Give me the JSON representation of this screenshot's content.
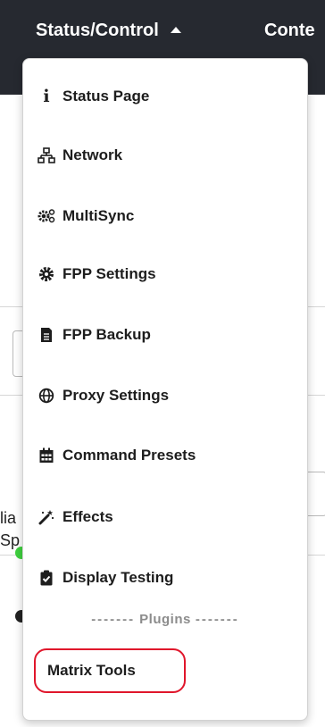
{
  "navbar": {
    "status_control_label": "Status/Control",
    "content_label_partial": "Conte"
  },
  "background": {
    "text_1": "lia",
    "text_2": "Sp"
  },
  "menu": {
    "items": [
      {
        "label": "Status Page",
        "icon": "info-icon"
      },
      {
        "label": "Network",
        "icon": "network-icon"
      },
      {
        "label": "MultiSync",
        "icon": "cogs-icon"
      },
      {
        "label": "FPP Settings",
        "icon": "gear-icon"
      },
      {
        "label": "FPP Backup",
        "icon": "file-icon"
      },
      {
        "label": "Proxy Settings",
        "icon": "globe-icon"
      },
      {
        "label": "Command Presets",
        "icon": "calendar-icon"
      },
      {
        "label": "Effects",
        "icon": "magic-wand-icon"
      },
      {
        "label": "Display Testing",
        "icon": "clipboard-check-icon"
      }
    ],
    "plugins_header": {
      "dashes_left": "-------",
      "label": "Plugins",
      "dashes_right": "-------"
    },
    "plugin_items": [
      {
        "label": "Matrix Tools",
        "highlighted": true
      }
    ]
  },
  "colors": {
    "navbar": "#262930",
    "highlight_border": "#e0162b",
    "status_green": "#3fd13f"
  }
}
